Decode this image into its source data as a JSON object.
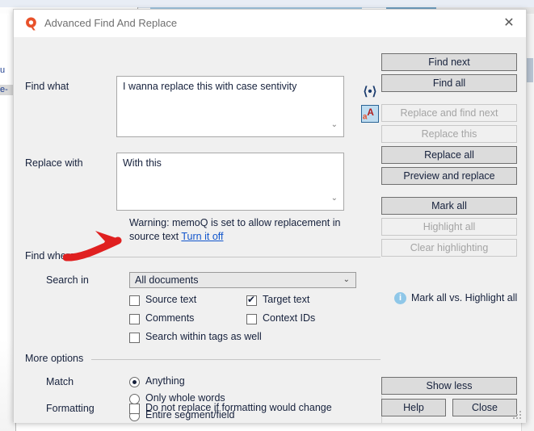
{
  "background": {
    "left_fragments": [
      "u",
      "e-"
    ]
  },
  "dialog": {
    "title": "Advanced Find And Replace",
    "logo_icon": "memoq-logo-icon",
    "close_icon": "close-icon"
  },
  "find_what": {
    "label": "Find what",
    "value": "I wanna replace this with case sentivity",
    "chevron_icon": "chevron-down-icon",
    "tag_icon": "insert-tag-icon",
    "case_icon": "case-sensitivity-icon",
    "case_icon_text": "aA"
  },
  "replace_with": {
    "label": "Replace with",
    "value": "With this",
    "chevron_icon": "chevron-down-icon"
  },
  "warning": {
    "text": "Warning: memoQ is set to allow replacement in source text ",
    "link": "Turn it off"
  },
  "find_where": {
    "group_label": "Find where",
    "search_in_label": "Search in",
    "search_in_value": "All documents",
    "search_in_arrow_icon": "chevron-down-icon",
    "checkboxes": [
      {
        "label": "Source text",
        "checked": false,
        "name": "source-text"
      },
      {
        "label": "Target text",
        "checked": true,
        "name": "target-text"
      },
      {
        "label": "Comments",
        "checked": false,
        "name": "comments"
      },
      {
        "label": "Context IDs",
        "checked": false,
        "name": "context-ids"
      },
      {
        "label": "Search within tags as well",
        "checked": false,
        "name": "search-within-tags"
      }
    ]
  },
  "more_options": {
    "group_label": "More options",
    "match_label": "Match",
    "radios": [
      {
        "label": "Anything",
        "selected": true,
        "name": "match-anything"
      },
      {
        "label": "Only whole words",
        "selected": false,
        "name": "match-whole-words"
      },
      {
        "label": "Entire segment/field",
        "selected": false,
        "name": "match-entire-segment"
      }
    ],
    "formatting_label": "Formatting",
    "formatting_checkbox": {
      "label": "Do not replace if formatting would change",
      "checked": false
    }
  },
  "actions": {
    "find_next": {
      "label": "Find next",
      "enabled": true
    },
    "find_all": {
      "label": "Find all",
      "enabled": true
    },
    "replace_and_find_next": {
      "label": "Replace and find next",
      "enabled": false
    },
    "replace_this": {
      "label": "Replace this",
      "enabled": false
    },
    "replace_all": {
      "label": "Replace all",
      "enabled": true
    },
    "preview_and_replace": {
      "label": "Preview and replace",
      "enabled": true
    },
    "mark_all": {
      "label": "Mark all",
      "enabled": true
    },
    "highlight_all": {
      "label": "Highlight all",
      "enabled": false
    },
    "clear_highlighting": {
      "label": "Clear highlighting",
      "enabled": false
    },
    "info_link": "Mark all vs. Highlight all",
    "info_icon": "info-icon",
    "show_less": {
      "label": "Show less",
      "enabled": true
    },
    "help": {
      "label": "Help",
      "enabled": true
    },
    "close": {
      "label": "Close",
      "enabled": true
    }
  },
  "annotation": {
    "arrow_color": "#e02020",
    "points_at": "search-in-dropdown"
  },
  "colors": {
    "dialog_bg": "#f0f0f0",
    "title_bg": "#ffffff",
    "text": "#16213c",
    "button_bg": "#dcdcdc",
    "link": "#1155cc",
    "accent": "#e8512a"
  }
}
